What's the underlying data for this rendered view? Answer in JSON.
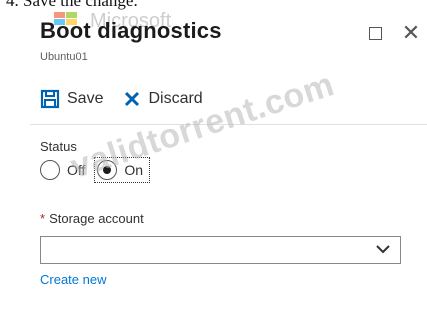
{
  "caption": "4. Save the change.",
  "blade": {
    "title": "Boot diagnostics",
    "subtitle": "Ubuntu01"
  },
  "toolbar": {
    "save_label": "Save",
    "discard_label": "Discard"
  },
  "status": {
    "label": "Status",
    "options": [
      "Off",
      "On"
    ],
    "selected": "On"
  },
  "storage": {
    "label": "Storage account",
    "required_marker": "*",
    "value": "",
    "create_new_label": "Create new"
  },
  "watermarks": {
    "brand": "Microsoft",
    "site": "validtorrent.com"
  },
  "colors": {
    "accent": "#0078d4",
    "required": "#a4262c",
    "save_icon": "#0063b1",
    "discard_icon": "#0063b1"
  }
}
